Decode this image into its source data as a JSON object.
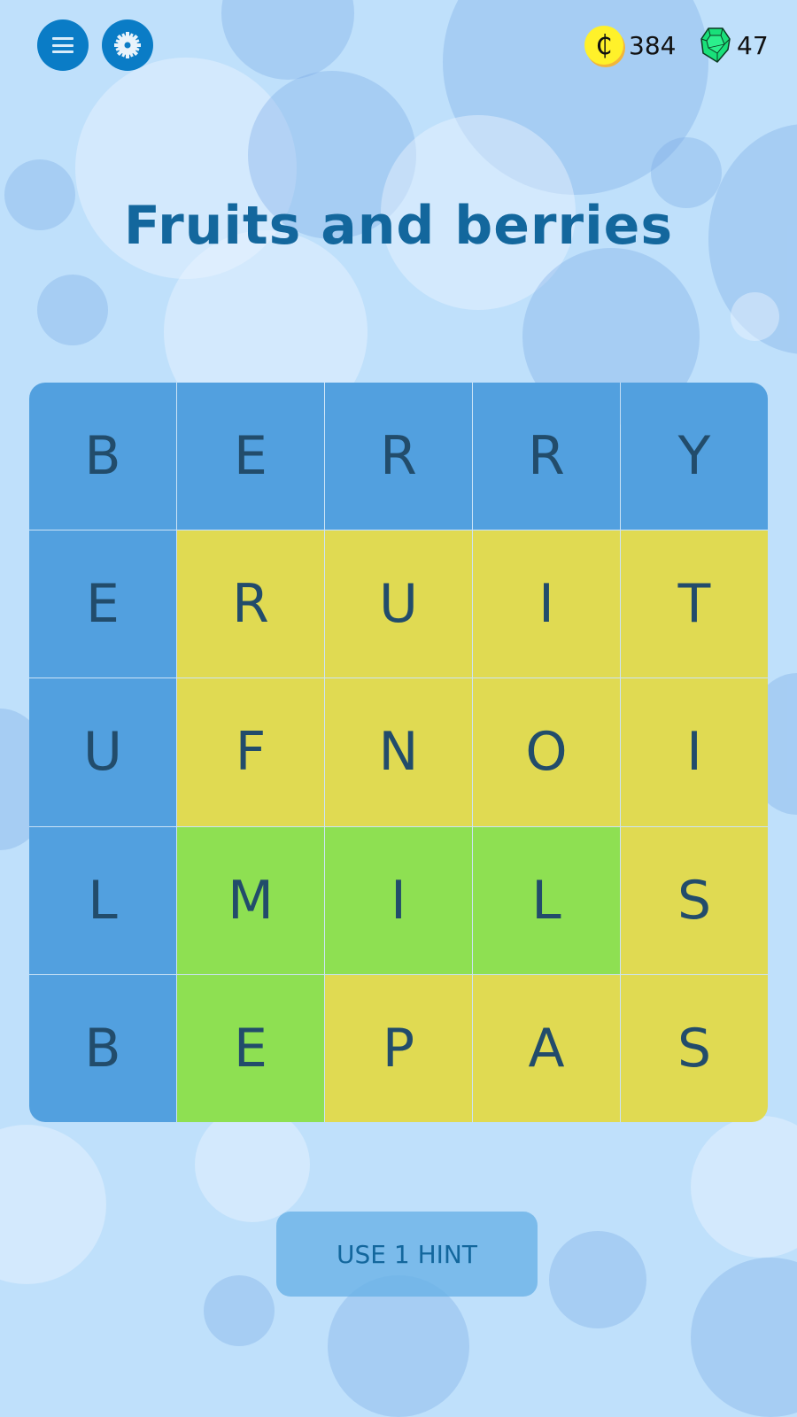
{
  "header": {
    "menu_icon": "hamburger-menu-icon",
    "settings_icon": "gear-icon",
    "coins": {
      "icon": "coin-icon",
      "symbol": "₵",
      "value": "384"
    },
    "gems": {
      "icon": "emerald-gem-icon",
      "value": "47"
    }
  },
  "puzzle": {
    "title": "Fruits and berries",
    "colors": {
      "blue": "#52a0df",
      "yellow": "#e0da52",
      "green": "#8ee052"
    },
    "grid": [
      [
        {
          "letter": "B",
          "color": "blue"
        },
        {
          "letter": "E",
          "color": "blue"
        },
        {
          "letter": "R",
          "color": "blue"
        },
        {
          "letter": "R",
          "color": "blue"
        },
        {
          "letter": "Y",
          "color": "blue"
        }
      ],
      [
        {
          "letter": "E",
          "color": "blue"
        },
        {
          "letter": "R",
          "color": "yellow"
        },
        {
          "letter": "U",
          "color": "yellow"
        },
        {
          "letter": "I",
          "color": "yellow"
        },
        {
          "letter": "T",
          "color": "yellow"
        }
      ],
      [
        {
          "letter": "U",
          "color": "blue"
        },
        {
          "letter": "F",
          "color": "yellow"
        },
        {
          "letter": "N",
          "color": "yellow"
        },
        {
          "letter": "O",
          "color": "yellow"
        },
        {
          "letter": "I",
          "color": "yellow"
        }
      ],
      [
        {
          "letter": "L",
          "color": "blue"
        },
        {
          "letter": "M",
          "color": "green"
        },
        {
          "letter": "I",
          "color": "green"
        },
        {
          "letter": "L",
          "color": "green"
        },
        {
          "letter": "S",
          "color": "yellow"
        }
      ],
      [
        {
          "letter": "B",
          "color": "blue"
        },
        {
          "letter": "E",
          "color": "green"
        },
        {
          "letter": "P",
          "color": "yellow"
        },
        {
          "letter": "A",
          "color": "yellow"
        },
        {
          "letter": "S",
          "color": "yellow"
        }
      ]
    ]
  },
  "hint_button": {
    "label": "USE 1 HINT"
  }
}
